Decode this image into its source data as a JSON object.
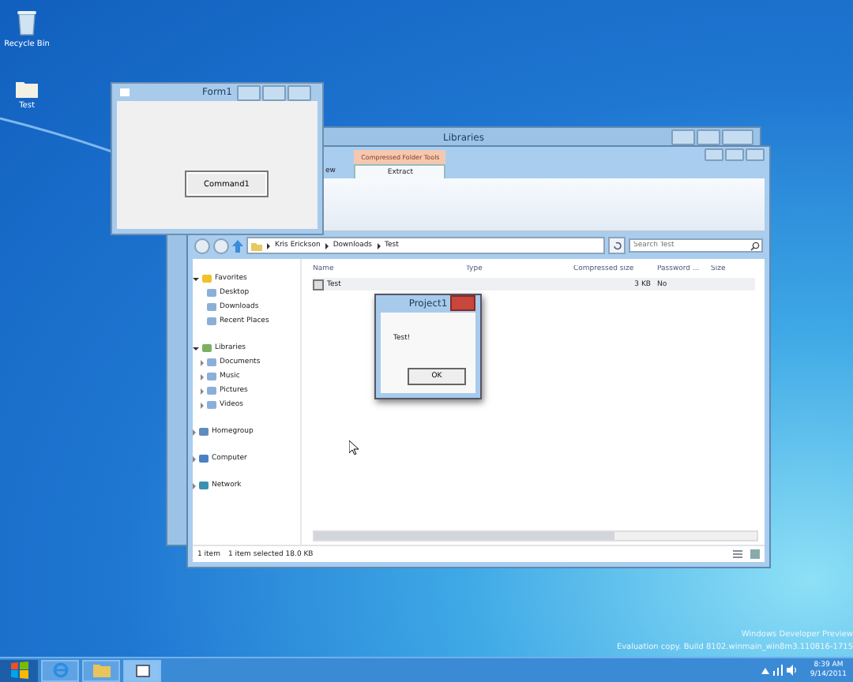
{
  "desktop_icons": [
    {
      "label": "Recycle Bin"
    },
    {
      "label": "Test"
    }
  ],
  "form1": {
    "title": "Form1",
    "button": "Command1"
  },
  "back_window": {
    "title": "Libraries"
  },
  "explorer": {
    "context_label": "Compressed Folder Tools",
    "tabs": [
      {
        "label": "ew",
        "selected": false
      },
      {
        "label": "Extract",
        "selected": true
      }
    ],
    "path": [
      "Kris Erickson",
      "Downloads",
      "Test"
    ],
    "search": {
      "placeholder": "Search Test"
    },
    "columns": [
      "Name",
      "Type",
      "Compressed size",
      "Password ...",
      "Size"
    ],
    "rows": [
      {
        "name": "Test",
        "compressed": "3 KB",
        "password": "No",
        "selected": true
      }
    ],
    "nav": [
      {
        "label": "Favorites",
        "expanded": true,
        "children": [
          {
            "label": "Desktop"
          },
          {
            "label": "Downloads"
          },
          {
            "label": "Recent Places"
          }
        ]
      },
      {
        "label": "Libraries",
        "expanded": true,
        "children": [
          {
            "label": "Documents",
            "expanded": false
          },
          {
            "label": "Music",
            "expanded": false
          },
          {
            "label": "Pictures",
            "expanded": false
          },
          {
            "label": "Videos",
            "expanded": false
          }
        ]
      },
      {
        "label": "Homegroup",
        "expanded": false
      },
      {
        "label": "Computer",
        "expanded": false
      },
      {
        "label": "Network",
        "expanded": false
      }
    ],
    "status": [
      "1 item",
      "1 item selected 18.0 KB"
    ]
  },
  "dialog": {
    "title": "Project1",
    "message": "Test!",
    "button": "OK"
  },
  "watermark": [
    "Windows Developer Preview",
    "Evaluation copy. Build 8102.winmain_win8m3.110816-1715"
  ],
  "clock": {
    "time": "8:39 AM",
    "date": "9/14/2011"
  }
}
